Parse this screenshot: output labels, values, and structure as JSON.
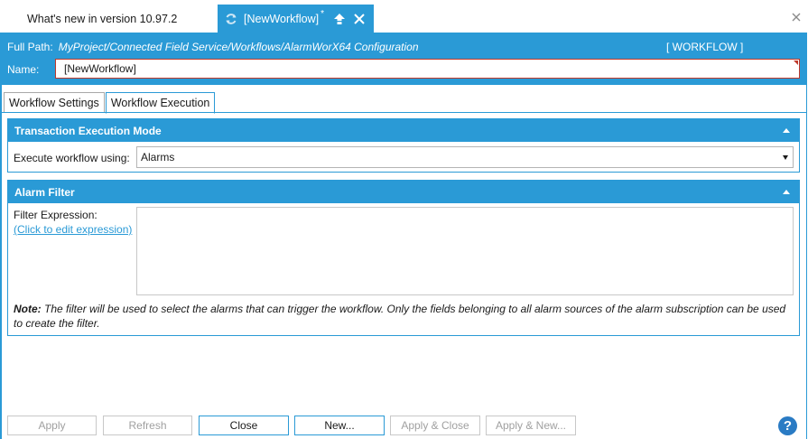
{
  "doc_tabs": {
    "inactive_label": "What's new in version 10.97.2",
    "active_label": "[NewWorkflow]",
    "active_modified_marker": "*"
  },
  "header": {
    "path_label": "Full Path:",
    "path_value": "MyProject/Connected Field Service/Workflows/AlarmWorX64 Configuration",
    "type_label": "[ WORKFLOW ]",
    "name_label": "Name:",
    "name_value": "[NewWorkflow]"
  },
  "sub_tabs": [
    {
      "label": "Workflow Settings",
      "selected": false
    },
    {
      "label": "Workflow Execution",
      "selected": true
    }
  ],
  "sections": {
    "execution_mode": {
      "title": "Transaction Execution Mode",
      "field_label": "Execute workflow using:",
      "field_value": "Alarms"
    },
    "alarm_filter": {
      "title": "Alarm Filter",
      "field_label": "Filter Expression:",
      "link_label": "(Click to edit expression)",
      "note_prefix": "Note:",
      "note_text": " The filter will be used to select the alarms that can trigger the workflow. Only the fields belonging to all alarm sources of the alarm subscription can be used to create the filter."
    }
  },
  "buttons": {
    "apply": "Apply",
    "refresh": "Refresh",
    "close": "Close",
    "new": "New...",
    "apply_close": "Apply & Close",
    "apply_new": "Apply & New..."
  },
  "help": "?",
  "colors": {
    "accent": "#2a9ad6",
    "error_border": "#c0392b"
  }
}
